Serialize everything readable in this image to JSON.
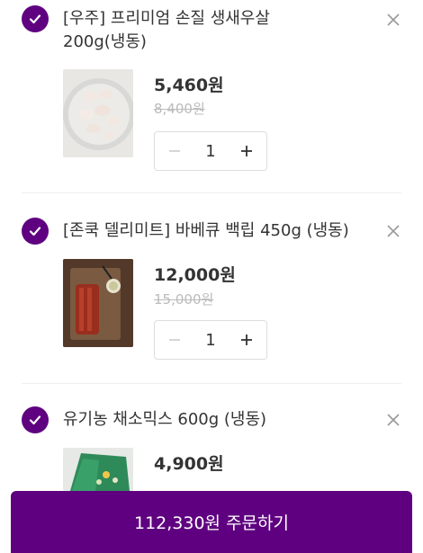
{
  "cart": {
    "items": [
      {
        "title_line1": "[우주] 프리미엄 손질 생새우살",
        "title_line2": "200g(냉동)",
        "price": "5,460원",
        "original_price": "8,400원",
        "quantity": "1",
        "selected": true
      },
      {
        "title_line1": "[존쿡 델리미트] 바베큐 백립 450g (냉동)",
        "price": "12,000원",
        "original_price": "15,000원",
        "quantity": "1",
        "selected": true
      },
      {
        "title_line1": "유기농 채소믹스 600g (냉동)",
        "price": "4,900원",
        "selected": true
      }
    ]
  },
  "order_button": {
    "label": "112,330원 주문하기"
  },
  "colors": {
    "accent": "#5f0080",
    "strike_price": "#bbbbbb",
    "border": "#dddddd"
  },
  "icons": {
    "check": "check-icon",
    "remove": "close-icon",
    "minus": "minus-icon",
    "plus": "plus-icon"
  }
}
